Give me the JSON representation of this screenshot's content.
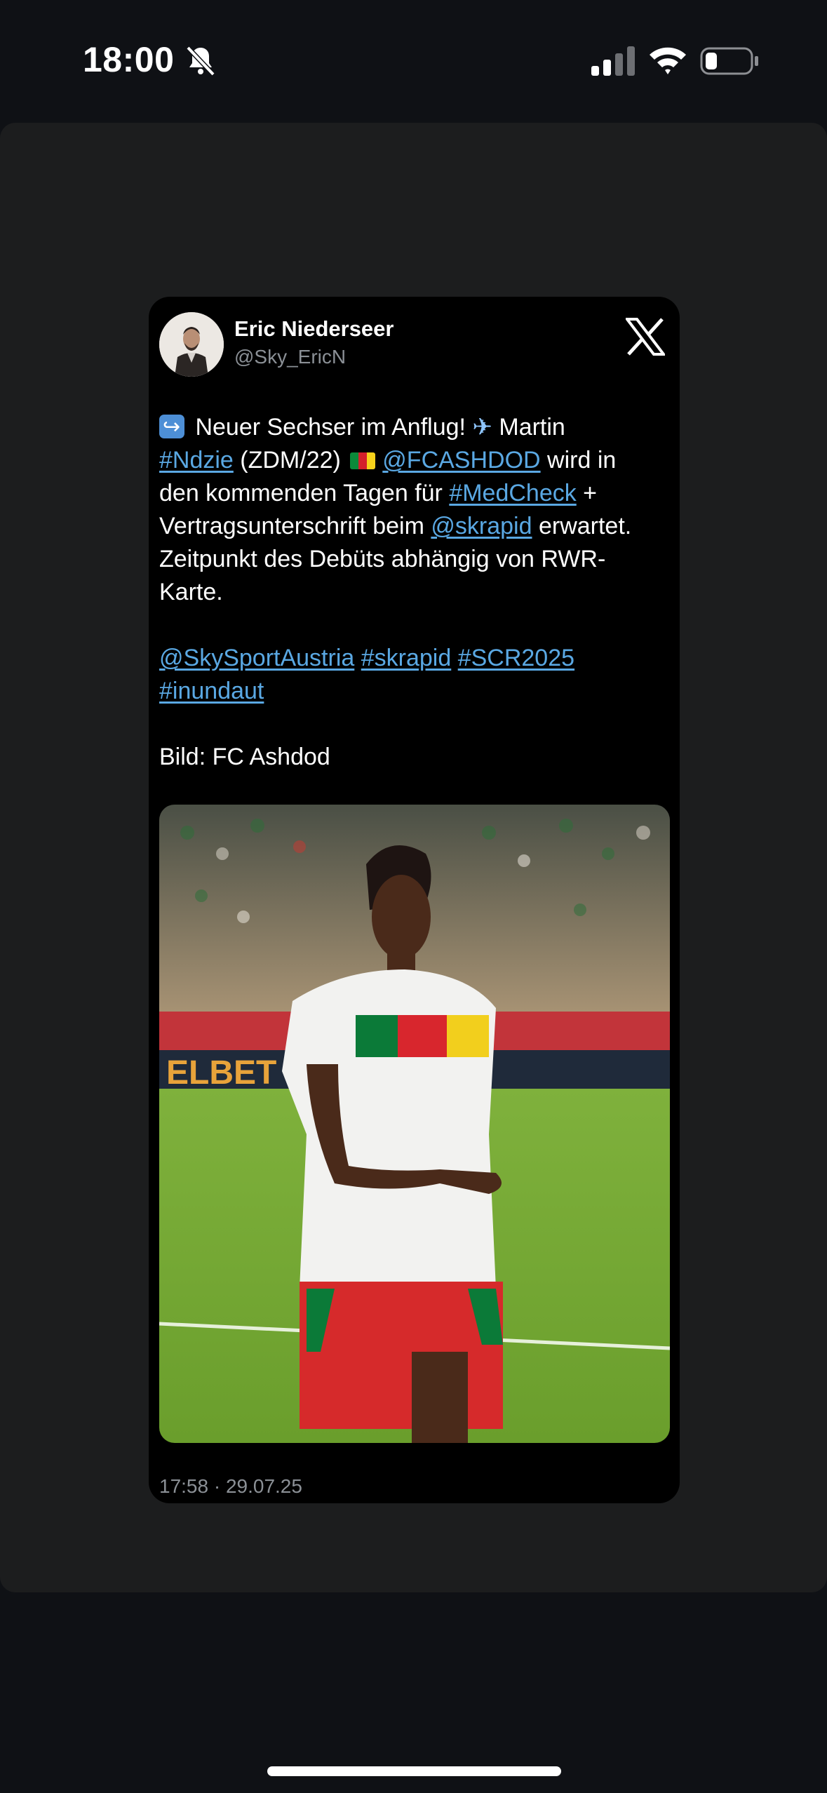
{
  "status_bar": {
    "time": "18:00",
    "icons": [
      "bell-slash-icon",
      "cellular-signal-icon",
      "wifi-icon",
      "battery-icon"
    ]
  },
  "tweet": {
    "author_name": "Eric Niederseer",
    "author_handle": "@Sky_EricN",
    "platform_logo": "x-logo-icon",
    "text": {
      "l1_a": " Neuer Sechser im Anflug! ",
      "l1_b": " Martin",
      "l2_tag": "#Ndzie",
      "l2_a": " (ZDM/22) ",
      "l2_tag2": "@FCASHDOD",
      "l2_b": " wird in",
      "l3_a": "den kommenden Tagen für ",
      "l3_tag": "#MedCheck",
      "l3_b": " +",
      "l4_a": "Vertragsunterschrift beim ",
      "l4_tag": "@skrapid",
      "l4_b": " erwartet.",
      "l5": "Zeitpunkt des Debüts abhängig von RWR-",
      "l6": "Karte.",
      "l8_tag1": "@SkySportAustria",
      "l8_tag2": "#skrapid",
      "l8_tag3": "#SCR2025",
      "l9_tag": "#inundaut",
      "l11": "Bild: FC Ashdod"
    },
    "timestamp": "17:58 · 29.07.25",
    "photo_alt": "football player in white and red kit warming up on pitch"
  },
  "colors": {
    "background": "#0f1115",
    "sheet": "#1c1d1e",
    "card": "#000000",
    "link": "#5aa8e3",
    "muted": "#8b9096"
  }
}
